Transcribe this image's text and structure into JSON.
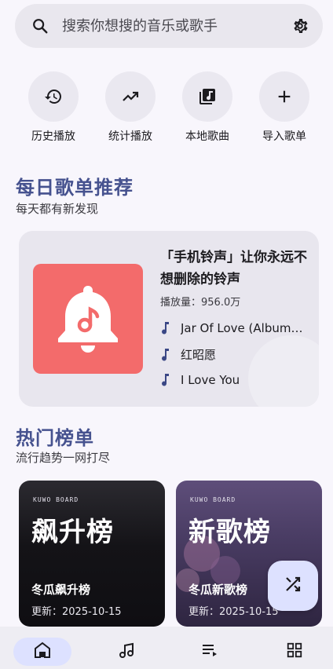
{
  "search": {
    "placeholder": "搜索你想搜的音乐或歌手",
    "search_icon": "search-icon",
    "settings_icon": "gear-icon"
  },
  "actions": [
    {
      "label": "历史播放",
      "icon": "history-icon"
    },
    {
      "label": "统计播放",
      "icon": "trending-up-icon"
    },
    {
      "label": "本地歌曲",
      "icon": "library-music-icon"
    },
    {
      "label": "导入歌单",
      "icon": "plus-icon"
    }
  ],
  "daily": {
    "title": "每日歌单推荐",
    "subtitle": "每天都有新发现",
    "playlist_title": "「手机铃声」让你永远不想删除的铃声",
    "plays": "播放量：956.0万",
    "cover_color": "#f36b6b",
    "songs": [
      "Jar Of Love (Album Version)",
      "红昭愿",
      "I Love You"
    ]
  },
  "hot": {
    "title": "热门榜单",
    "subtitle": "流行趋势一网打尽",
    "charts": [
      {
        "big": "飙升榜",
        "name": "冬瓜飙升榜",
        "date": "更新：2025-10-15",
        "tag": "KUWO BOARD"
      },
      {
        "big": "新歌榜",
        "name": "冬瓜新歌榜",
        "date": "更新：2025-10-15",
        "tag": "KUWO BOARD"
      }
    ]
  },
  "fab": {
    "icon": "shuffle-icon"
  },
  "nav": [
    {
      "icon": "home-icon",
      "active": true
    },
    {
      "icon": "music-note-icon",
      "active": false
    },
    {
      "icon": "queue-icon",
      "active": false
    },
    {
      "icon": "grid-icon",
      "active": false
    }
  ],
  "colors": {
    "accent": "#46528f",
    "nav_active": "#dde1ff",
    "background": "#f8f6fc"
  }
}
